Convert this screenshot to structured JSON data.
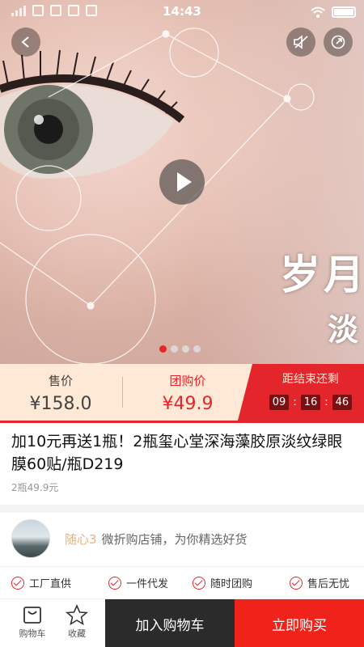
{
  "status_bar": {
    "time": "14:43"
  },
  "hero": {
    "overlay_line1": "岁月",
    "overlay_line2": "淡",
    "carousel_total": 4,
    "carousel_active": 1
  },
  "price_band": {
    "sale_label": "售价",
    "sale_price": "¥158.0",
    "group_label": "团购价",
    "group_price": "¥49.9",
    "countdown_label": "距结束还剩",
    "countdown": {
      "hours": "09",
      "minutes": "16",
      "seconds": "46"
    }
  },
  "product": {
    "title": "加10元再送1瓶！2瓶玺心堂深海藻胶原淡纹绿眼膜60贴/瓶D219",
    "subnote": "2瓶49.9元"
  },
  "shop": {
    "name": "随心3",
    "tagline": "微折购店铺，为你精选好货"
  },
  "guarantees": [
    "工厂直供",
    "一件代发",
    "随时团购",
    "售后无忧"
  ],
  "bottom_bar": {
    "cart_label": "购物车",
    "favorite_label": "收藏",
    "add_to_cart": "加入购物车",
    "buy_now": "立即购买"
  },
  "colors": {
    "accent": "#e4262c",
    "price_band": "#fde9d5",
    "dark_button": "#2b2b2b",
    "shop_name": "#e8b27a"
  }
}
